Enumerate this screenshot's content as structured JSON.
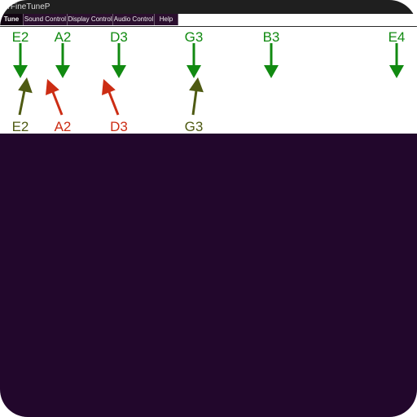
{
  "window": {
    "title": "arFineTuneP"
  },
  "tabs": [
    {
      "label": "Tune",
      "active": true
    },
    {
      "label": "Sound Control",
      "active": false
    },
    {
      "label": "Display Control",
      "active": false
    },
    {
      "label": "Audio Control",
      "active": false
    },
    {
      "label": "Help",
      "active": false
    }
  ],
  "tuner": {
    "targets": [
      {
        "note": "E2",
        "color": "#118a11"
      },
      {
        "note": "A2",
        "color": "#118a11"
      },
      {
        "note": "D3",
        "color": "#118a11"
      },
      {
        "note": "G3",
        "color": "#118a11"
      },
      {
        "note": "B3",
        "color": "#118a11"
      },
      {
        "note": "E4",
        "color": "#118a11"
      }
    ],
    "detected": [
      {
        "note": "E2",
        "color": "#4e5a12",
        "direction": "up-right"
      },
      {
        "note": "A2",
        "color": "#cc2d14",
        "direction": "up-left"
      },
      {
        "note": "D3",
        "color": "#cc2d14",
        "direction": "up-left"
      },
      {
        "note": "G3",
        "color": "#4e5a12",
        "direction": "up-right"
      }
    ]
  },
  "colors": {
    "background": "#ffffff",
    "spectrum_background": "#22072c",
    "tab_background": "#2b0f2e",
    "in_tune": "#118a11",
    "near_tune": "#4e5a12",
    "out_of_tune": "#cc2d14"
  }
}
